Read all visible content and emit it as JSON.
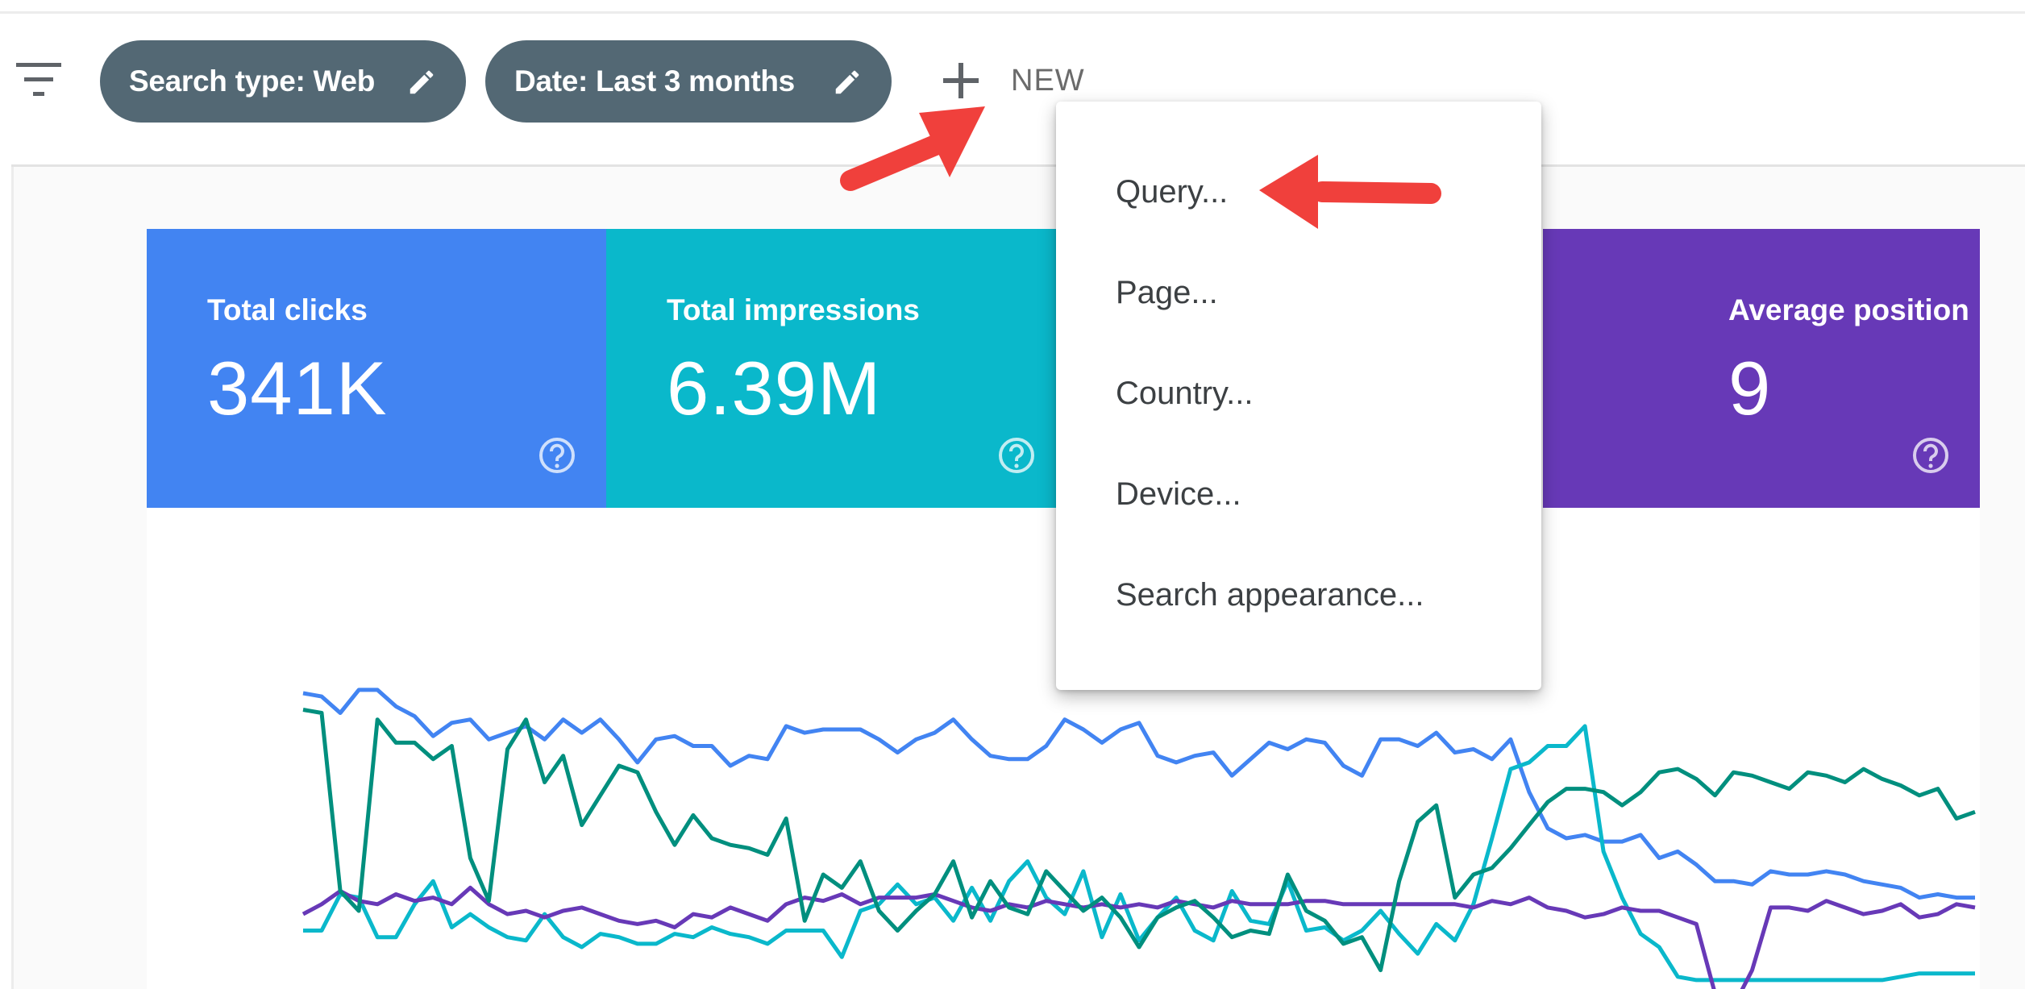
{
  "toolbar": {
    "filter_chips": [
      {
        "label": "Search type: Web"
      },
      {
        "label": "Date: Last 3 months"
      }
    ],
    "new_label": "NEW"
  },
  "metrics": [
    {
      "label": "Total clicks",
      "value": "341K",
      "color": "#4284f2"
    },
    {
      "label": "Total impressions",
      "value": "6.39M",
      "color": "#0ab8cb"
    },
    {
      "label": "",
      "value": "",
      "color": "#008f7e"
    },
    {
      "label": "Average position",
      "value": "9",
      "color": "#6739b7"
    }
  ],
  "dropdown": {
    "items": [
      "Query...",
      "Page...",
      "Country...",
      "Device...",
      "Search appearance..."
    ]
  },
  "icons": {
    "filter": "filter-icon",
    "edit": "pencil-icon",
    "add": "plus-icon",
    "help": "help-circle-icon"
  },
  "annotation_color": "#f0403c",
  "chart_data": {
    "type": "line",
    "x": [
      0,
      1,
      2,
      3,
      4,
      5,
      6,
      7,
      8,
      9,
      10,
      11,
      12,
      13,
      14,
      15,
      16,
      17,
      18,
      19,
      20,
      21,
      22,
      23,
      24,
      25,
      26,
      27,
      28,
      29,
      30,
      31,
      32,
      33,
      34,
      35,
      36,
      37,
      38,
      39,
      40,
      41,
      42,
      43,
      44,
      45,
      46,
      47,
      48,
      49,
      50,
      51,
      52,
      53,
      54,
      55,
      56,
      57,
      58,
      59,
      60,
      61,
      62,
      63,
      64,
      65,
      66,
      67,
      68,
      69,
      70,
      71,
      72,
      73,
      74,
      75,
      76,
      77,
      78,
      79,
      80,
      81,
      82,
      83,
      84,
      85,
      86,
      87,
      88,
      89,
      90
    ],
    "series": [
      {
        "color": "#4284f2",
        "values": [
          78,
          77,
          72,
          79,
          79,
          74,
          71,
          65,
          69,
          70,
          64,
          66,
          68,
          64,
          70,
          66,
          70,
          64,
          57,
          64,
          65,
          62,
          62,
          56,
          59,
          58,
          68,
          66,
          67,
          67,
          67,
          64,
          60,
          64,
          66,
          70,
          64,
          59,
          58,
          58,
          62,
          70,
          67,
          63,
          67,
          69,
          59,
          57,
          59,
          60,
          53,
          58,
          63,
          61,
          64,
          63,
          56,
          53,
          64,
          64,
          62,
          66,
          60,
          61,
          58,
          64,
          48,
          37,
          34,
          35,
          33,
          33,
          35,
          28,
          30,
          26,
          21,
          21,
          20,
          24,
          23,
          23,
          24,
          23,
          21,
          20,
          19,
          16,
          17,
          16,
          16
        ]
      },
      {
        "color": "#0ab8cb",
        "values": [
          6,
          6,
          17,
          16,
          4,
          4,
          14,
          21,
          7,
          11,
          7,
          4,
          3,
          11,
          4,
          1,
          5,
          4,
          2,
          2,
          5,
          4,
          7,
          5,
          4,
          2,
          6,
          6,
          6,
          -2,
          12,
          14,
          20,
          14,
          16,
          9,
          19,
          9,
          21,
          27,
          16,
          11,
          24,
          4,
          17,
          3,
          10,
          16,
          6,
          3,
          18,
          9,
          8,
          21,
          6,
          7,
          3,
          6,
          12,
          5,
          -1,
          8,
          3,
          14,
          34,
          55,
          57,
          62,
          62,
          68,
          30,
          16,
          5,
          1,
          -8,
          -9,
          -9,
          -9,
          -9,
          -9,
          -9,
          -9,
          -9,
          -9,
          -9,
          -9,
          -8,
          -7,
          -7,
          -7,
          -7
        ]
      },
      {
        "color": "#6739b7",
        "values": [
          11,
          14,
          18,
          15,
          14,
          17,
          15,
          16,
          14,
          19,
          14,
          11,
          12,
          10,
          12,
          13,
          11,
          9,
          8,
          9,
          7,
          11,
          10,
          13,
          11,
          9,
          14,
          16,
          15,
          17,
          14,
          16,
          16,
          16,
          17,
          15,
          13,
          12,
          14,
          13,
          15,
          14,
          13,
          14,
          13,
          14,
          13,
          15,
          14,
          13,
          15,
          14,
          14,
          14,
          15,
          15,
          14,
          14,
          14,
          14,
          14,
          14,
          14,
          13,
          15,
          14,
          16,
          13,
          12,
          10,
          11,
          13,
          12,
          12,
          10,
          8,
          -13,
          -17,
          -6,
          13,
          13,
          12,
          15,
          13,
          11,
          12,
          14,
          10,
          11,
          14,
          13
        ]
      },
      {
        "color": "#008f7e",
        "values": [
          73,
          72,
          18,
          12,
          70,
          63,
          63,
          58,
          62,
          28,
          15,
          61,
          70,
          51,
          59,
          38,
          47,
          56,
          54,
          42,
          32,
          41,
          34,
          32,
          31,
          29,
          40,
          9,
          23,
          19,
          27,
          12,
          6,
          12,
          17,
          27,
          10,
          21,
          13,
          11,
          24,
          18,
          12,
          16,
          10,
          1,
          10,
          13,
          15,
          10,
          4,
          6,
          5,
          23,
          12,
          9,
          2,
          4,
          -6,
          21,
          39,
          44,
          16,
          23,
          25,
          31,
          38,
          45,
          49,
          49,
          48,
          44,
          48,
          54,
          55,
          52,
          47,
          54,
          53,
          51,
          49,
          54,
          53,
          51,
          55,
          52,
          50,
          47,
          49,
          40,
          42
        ]
      }
    ]
  }
}
